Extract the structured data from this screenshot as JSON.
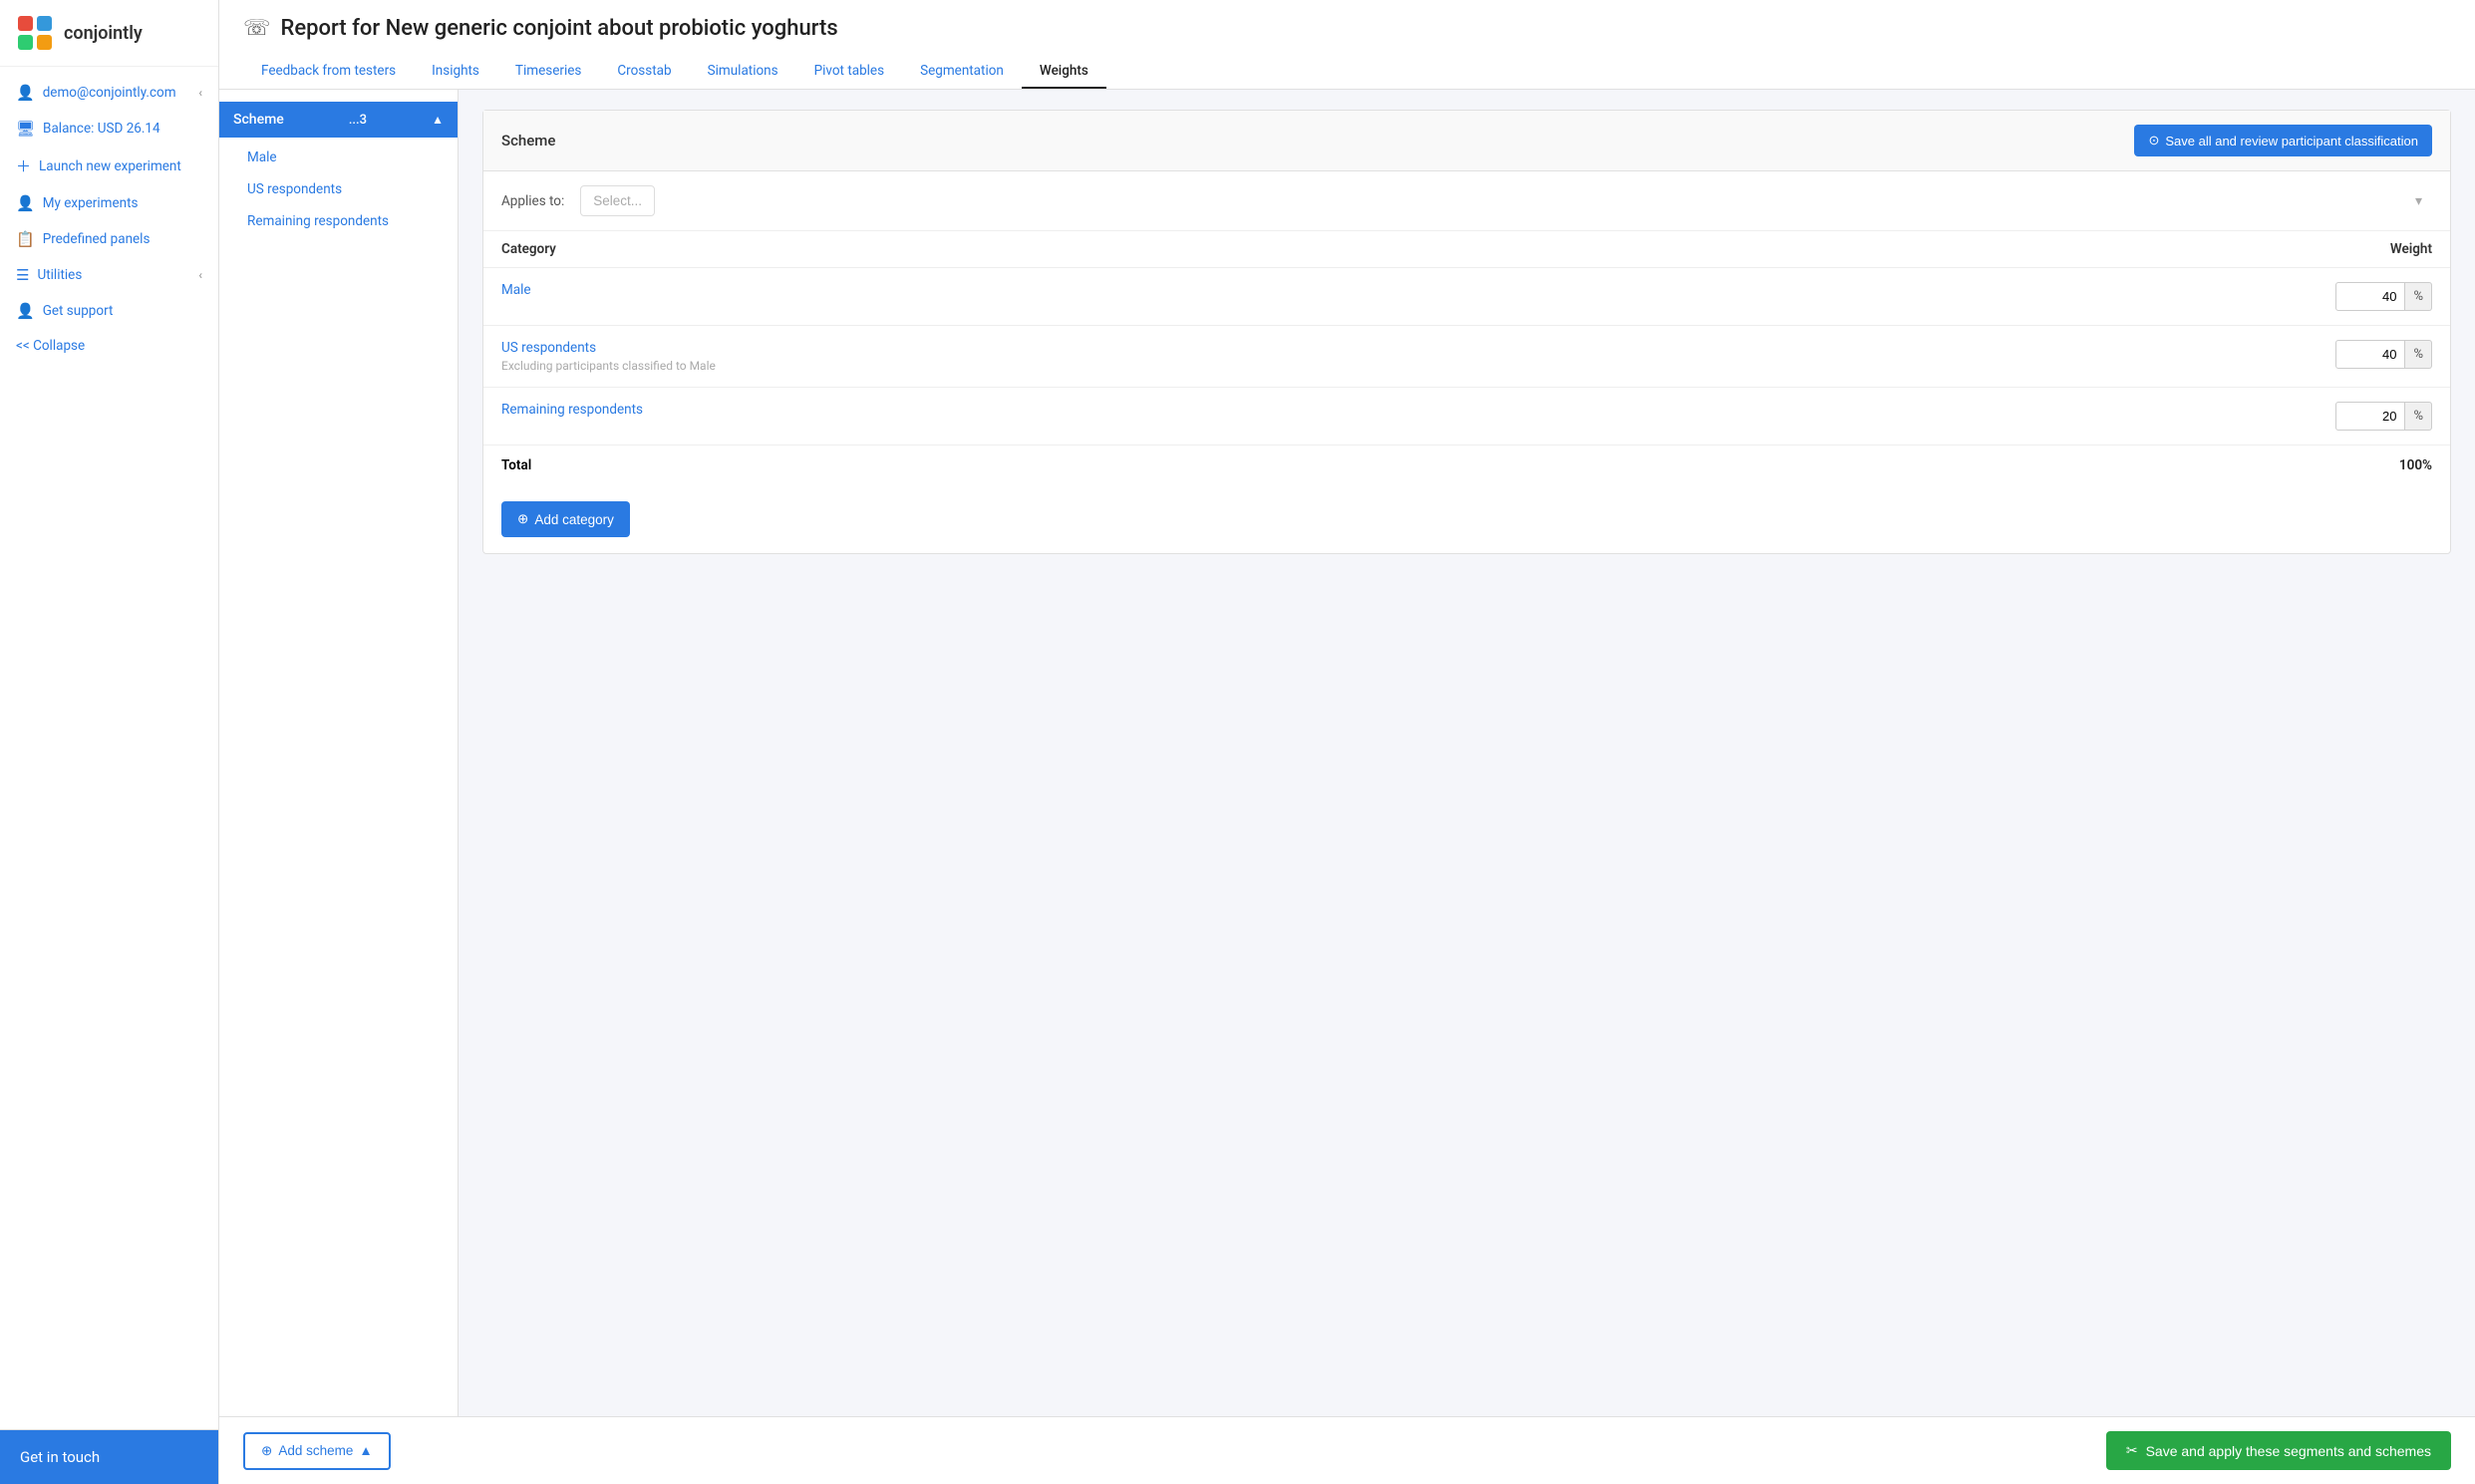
{
  "app": {
    "logo_text": "conjointly"
  },
  "sidebar": {
    "user_email": "demo@conjointly.com",
    "balance_label": "Balance: USD 26.14",
    "launch_label": "Launch new experiment",
    "my_experiments_label": "My experiments",
    "predefined_panels_label": "Predefined panels",
    "utilities_label": "Utilities",
    "get_support_label": "Get support",
    "collapse_label": "<< Collapse",
    "get_in_touch_label": "Get in touch"
  },
  "page": {
    "title": "Report for New generic conjoint about probiotic yoghurts",
    "title_icon": "⚙"
  },
  "tabs": [
    {
      "label": "Feedback from testers",
      "active": false
    },
    {
      "label": "Insights",
      "active": false
    },
    {
      "label": "Timeseries",
      "active": false
    },
    {
      "label": "Crosstab",
      "active": false
    },
    {
      "label": "Simulations",
      "active": false
    },
    {
      "label": "Pivot tables",
      "active": false
    },
    {
      "label": "Segmentation",
      "active": false
    },
    {
      "label": "Weights",
      "active": true
    }
  ],
  "scheme_sidebar": {
    "scheme_label": "Scheme",
    "scheme_badge": "...3",
    "sub_items": [
      {
        "label": "Male"
      },
      {
        "label": "US respondents"
      },
      {
        "label": "Remaining respondents"
      }
    ]
  },
  "panel": {
    "title": "Scheme",
    "save_all_btn": "Save all and review participant classification",
    "applies_label": "Applies to:",
    "applies_placeholder": "Select...",
    "category_col": "Category",
    "weight_col": "Weight",
    "categories": [
      {
        "name": "Male",
        "sub": "",
        "weight": "40"
      },
      {
        "name": "US respondents",
        "sub": "Excluding participants classified to Male",
        "weight": "40"
      },
      {
        "name": "Remaining respondents",
        "sub": "",
        "weight": "20"
      }
    ],
    "total_label": "Total",
    "total_value": "100%",
    "add_category_btn": "Add category"
  },
  "footer": {
    "add_scheme_btn": "Add scheme",
    "save_apply_btn": "Save and apply these segments and schemes"
  }
}
